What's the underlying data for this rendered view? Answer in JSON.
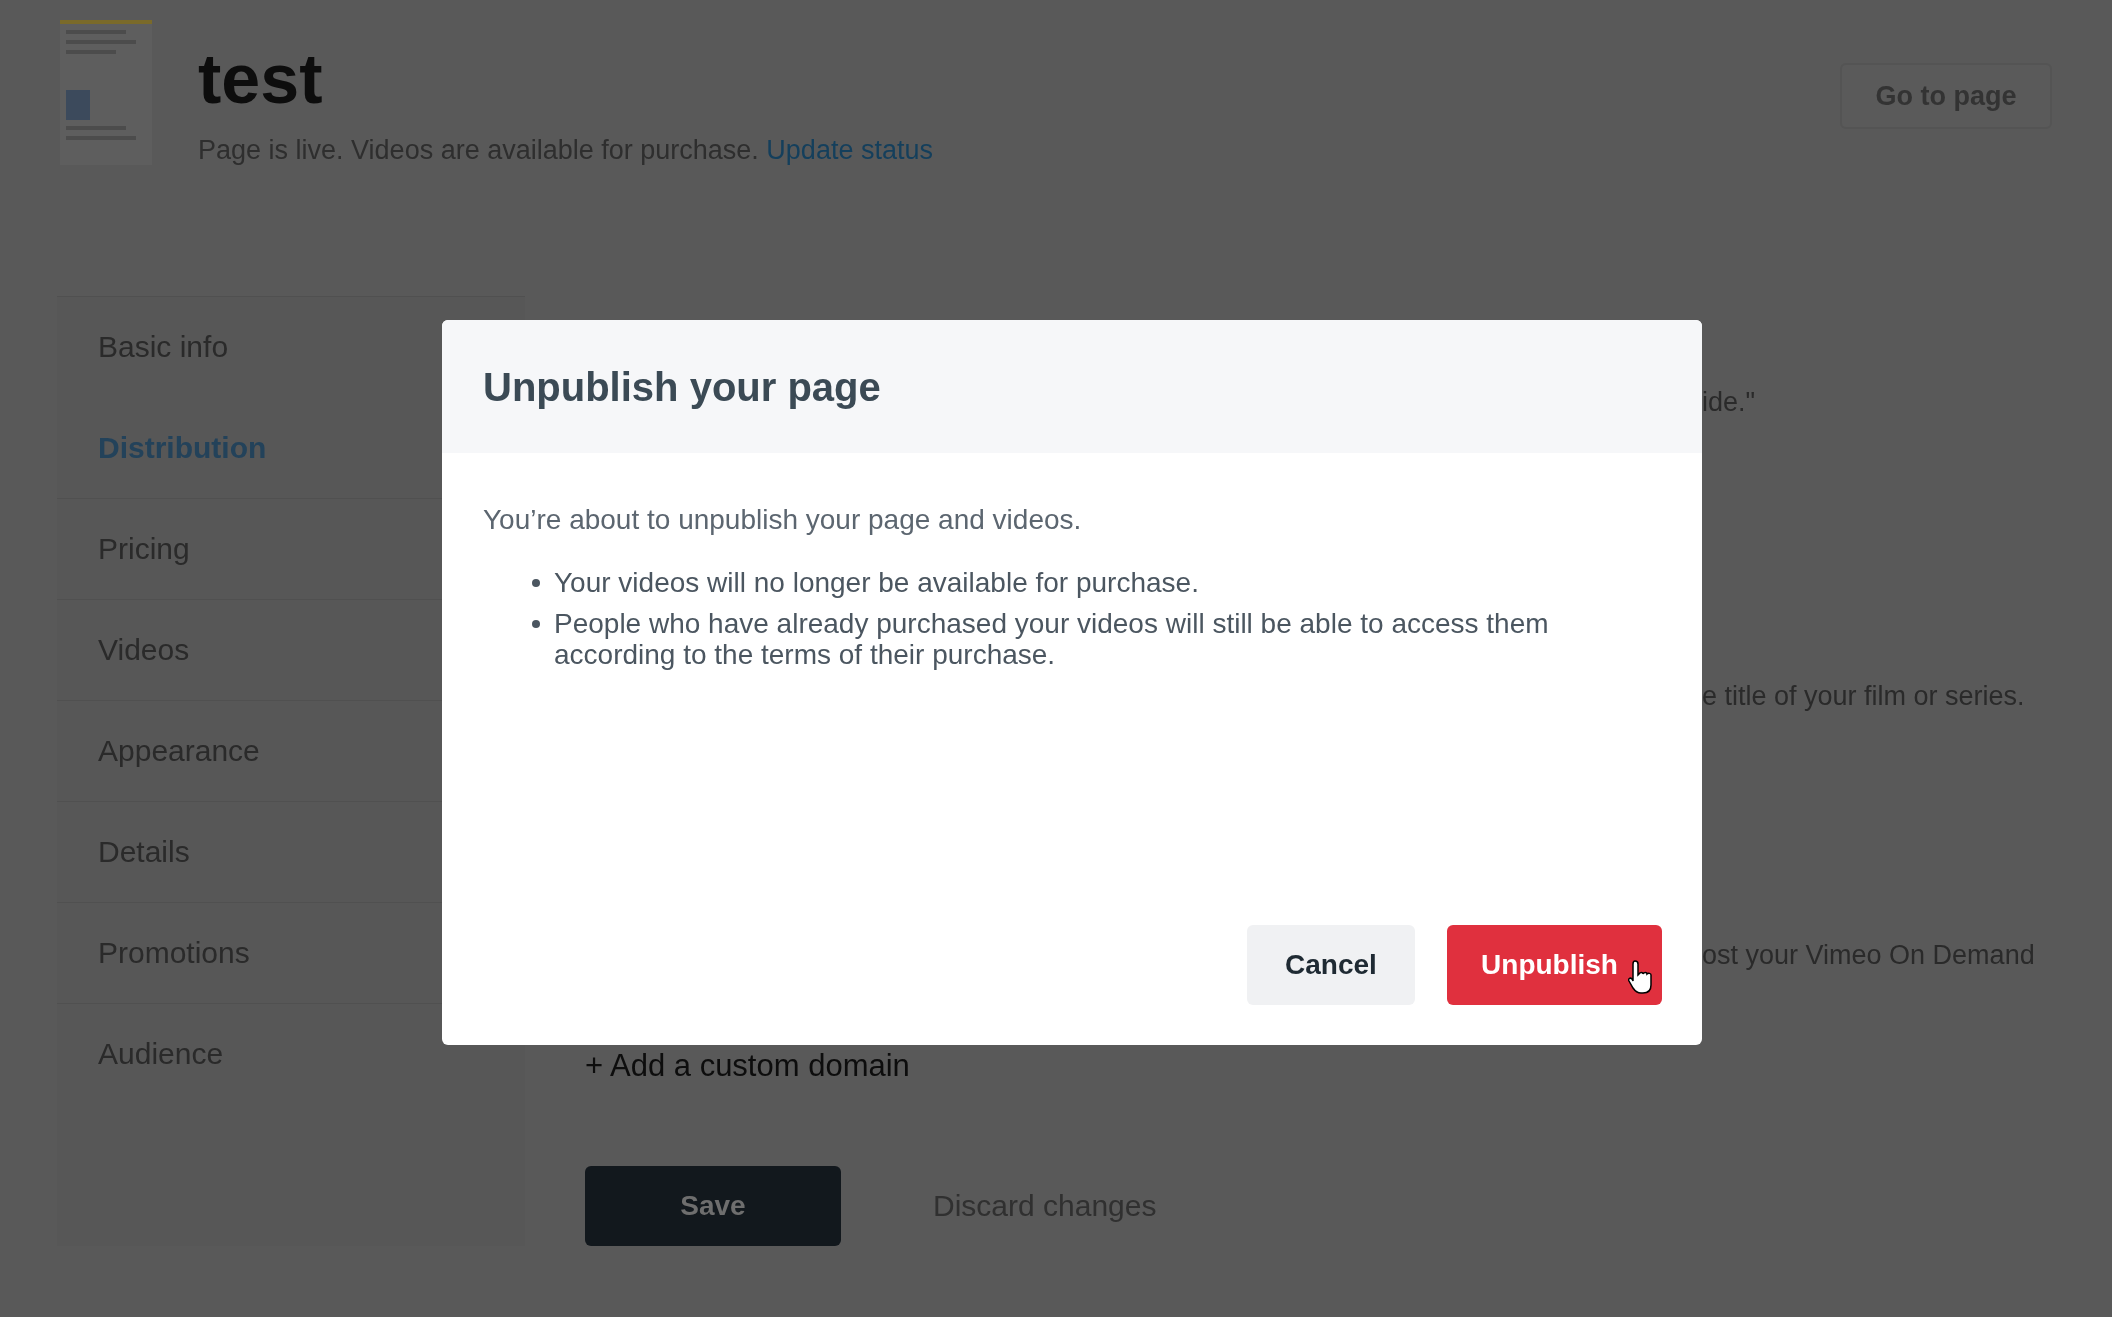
{
  "page": {
    "title": "test",
    "status": "Page is live. Videos are available for purchase.",
    "status_link": "Update status",
    "go_to_page": "Go to page"
  },
  "sidebar": {
    "items": [
      {
        "label": "Basic info",
        "selected": false
      },
      {
        "label": "Distribution",
        "selected": true
      },
      {
        "label": "Pricing",
        "selected": false
      },
      {
        "label": "Videos",
        "selected": false
      },
      {
        "label": "Appearance",
        "selected": false
      },
      {
        "label": "Details",
        "selected": false
      },
      {
        "label": "Promotions",
        "selected": false
      },
      {
        "label": "Audience",
        "selected": false
      }
    ]
  },
  "content": {
    "partial_texts": [
      "ide.\"",
      "e title of your film or series.",
      "ost your Vimeo On Demand"
    ],
    "add_domain_link": "+ Add a custom domain",
    "save_button": "Save",
    "discard_link": "Discard changes"
  },
  "modal": {
    "title": "Unpublish your page",
    "message": "You’re about to unpublish your page and videos.",
    "bullets": [
      "Your videos will no longer be available for purchase.",
      "People who have already purchased your videos will still be able to access them according to the terms of their purchase."
    ],
    "buttons": [
      {
        "label": "Cancel",
        "kind": "secondary"
      },
      {
        "label": "Unpublish",
        "kind": "danger"
      }
    ]
  }
}
